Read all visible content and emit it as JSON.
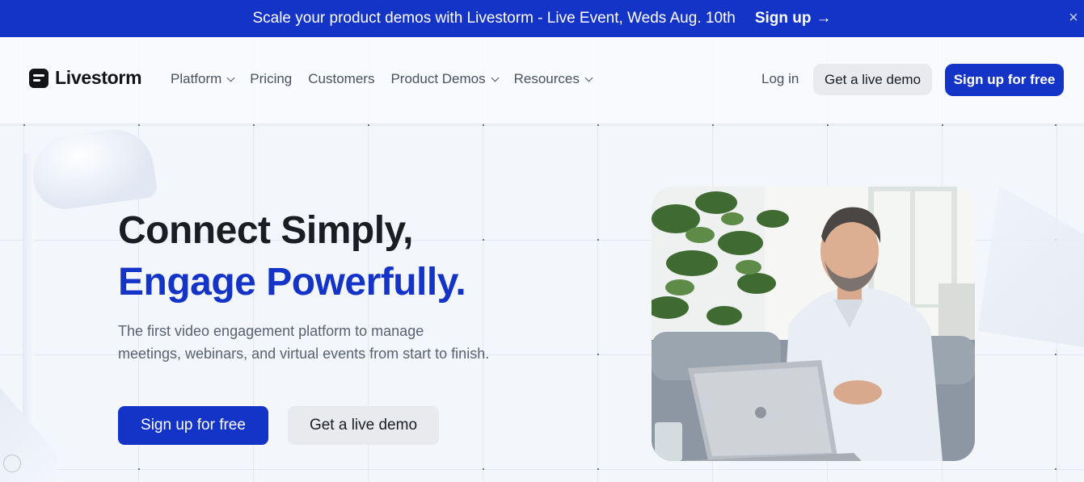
{
  "announcement": {
    "message": "Scale your product demos with Livestorm - Live Event, Weds Aug. 10th",
    "cta": "Sign up",
    "cta_arrow": "→",
    "close": "×"
  },
  "brand": {
    "name": "Livestorm",
    "primary_color": "#1433c7"
  },
  "nav": {
    "items": [
      {
        "label": "Platform",
        "dropdown": true
      },
      {
        "label": "Pricing",
        "dropdown": false
      },
      {
        "label": "Customers",
        "dropdown": false
      },
      {
        "label": "Product Demos",
        "dropdown": true
      },
      {
        "label": "Resources",
        "dropdown": true
      }
    ],
    "login": "Log in",
    "demo_button": "Get a live demo",
    "signup_button": "Sign up for free"
  },
  "hero": {
    "title_line1": "Connect Simply,",
    "title_line2": "Engage Powerfully.",
    "subtitle": "The first video engagement platform to manage meetings, webinars, and virtual events from start to finish.",
    "primary_cta": "Sign up for free",
    "secondary_cta": "Get a live demo"
  }
}
